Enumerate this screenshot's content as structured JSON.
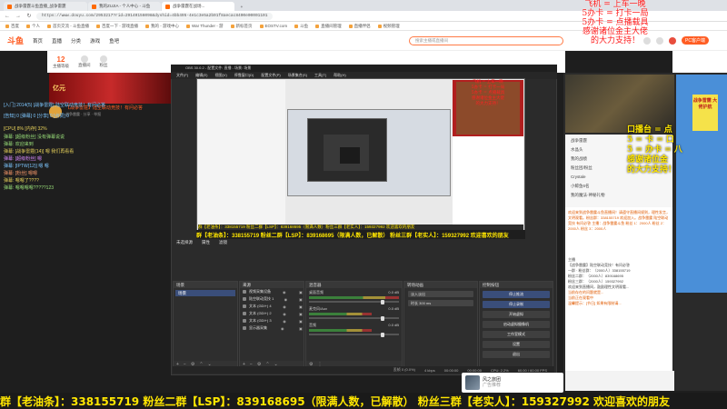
{
  "browser": {
    "tabs": [
      {
        "label": "战争雷霆斗鱼直播_战争雷霆",
        "active": false
      },
      {
        "label": "我的ZUJIA - 个人中心 - 斗鱼",
        "active": false
      },
      {
        "label": "战争雷霆在战场...",
        "active": true
      },
      {
        "label": "",
        "active": false
      }
    ],
    "url": "https://www.douyu.com/2953217?rid=29140156098&dyshid=4bb495-4e1c3e5a2b91f8aecac8400e00001101",
    "bookmarks": [
      "百度",
      "个人",
      "首页交流 - 斗鱼直播",
      "百度一下 - 游戏直播",
      "我的 - 游戏中心",
      "War Thunder - 游",
      "新标签页",
      "EOSTV.com",
      "斗鱼",
      "直播间管理",
      "直播伴侣",
      "视频管理"
    ]
  },
  "douyu": {
    "logo": "斗鱼",
    "nav": [
      "首页",
      "直播",
      "分类",
      "游戏",
      "鱼吧"
    ],
    "search_placeholder": "搜索主播或直播间",
    "pc_button": "PC客户端",
    "stats": [
      {
        "value": "12",
        "label": "主播等级"
      },
      {
        "value": "",
        "label": "直播间"
      },
      {
        "value": "",
        "label": "粉丝"
      }
    ],
    "banner": "亿元",
    "room_title": "【战争雷霆】陆空联动竞技！有问必答",
    "room_meta": "战争雷霆 · 分享 · 举报"
  },
  "chat_left": [
    {
      "text": "[入门] 2014(5) [战争雷霆] 陆空联动竞技！有问必答",
      "color": "c1"
    },
    {
      "text": "[告知] 0 [弹幕] 0 [分享] 0 [点赞] 0",
      "color": "c1"
    },
    {
      "text": "[CPU] 8% [内存] 32%",
      "color": "c2"
    },
    {
      "text": "弹幕: [超级粉丝] 没有弹幕说说",
      "color": "c3"
    },
    {
      "text": "弹幕: 欢迎来到",
      "color": "c3"
    },
    {
      "text": "弹幕: [战争雷霆(14)] 嗯 我们再看看",
      "color": "c2"
    },
    {
      "text": "弹幕: [超级粉丝] 嗯",
      "color": "c4"
    },
    {
      "text": "弹幕: [IPTW(12)] 嗯 嗯",
      "color": "c1"
    },
    {
      "text": "弹幕: [粉丝] 嗯嗯",
      "color": "c5"
    },
    {
      "text": "弹幕: 嗯嗯了????",
      "color": "c2"
    },
    {
      "text": "弹幕: 嗯嗯嗯嗯?????123",
      "color": "c3"
    }
  ],
  "obs": {
    "title": "OBS 30.0.2 - 配置文件: 直播 - 场景: 场景",
    "menu": [
      "文件(F)",
      "编辑(E)",
      "视图(V)",
      "停靠窗口(D)",
      "配置文件(P)",
      "场景集合(S)",
      "工具(T)",
      "帮助(H)"
    ],
    "preview_red_text": [
      "飞机 = 上车一晚",
      "5办卡 = 打卡一局",
      "5办卡 = 点播载具",
      "感谢诸位金主大佬",
      "的大力支持！"
    ],
    "preview_marquee": "群【老油条】：338155719  粉丝二群【LSP】：839168695（限满人数）粉丝三群【老实人】：159327992 欢迎喜欢的朋友",
    "marquee": "群【老油条】：338155719  粉丝二群【LSP】：839168695（限满人数，已解散）  粉丝三群【老实人】：159327992 欢迎喜欢的朋友",
    "scene_bar": [
      "未选择源",
      "属性",
      "滤镜"
    ],
    "docks": {
      "scenes": {
        "title": "场景",
        "items": [
          "场景"
        ]
      },
      "sources": {
        "title": "来源",
        "items": [
          "视频采集设备",
          "陆空联动竞技 1",
          "文本 (GDI+) 4",
          "文本 (GDI+) 2",
          "文本 (GDI+) 3",
          "显示器采集"
        ]
      },
      "mixer": {
        "title": "混音器",
        "channels": [
          {
            "name": "桌面音频",
            "db": "0.0 dB"
          },
          {
            "name": "麦克风/Aux",
            "db": "0.0 dB"
          },
          {
            "name": "音频",
            "db": "0.0 dB"
          }
        ]
      },
      "transitions": {
        "title": "转场动画",
        "type": "淡入淡出",
        "duration_label": "时长",
        "duration": "300 ms"
      },
      "controls": {
        "title": "控制按钮",
        "buttons": [
          "停止推流",
          "停止录制",
          "开始虚拟",
          "启动虚拟摄像机",
          "工作室模式",
          "设置",
          "退出"
        ]
      }
    },
    "status": [
      "丢帧 0 (0.0%)",
      "4 kbps",
      "00:00:00",
      "00:00:00",
      "CPU: 2.2%",
      "60.00 / 60.00 FPS"
    ]
  },
  "overlay_top_right": [
    "飞机 = 上车一晚",
    "5办卡 = 打卡一局",
    "5办卡 = 点播载具",
    "感谢诸位金主大佬",
    "的大力支持！"
  ],
  "overlay_right": [
    "口播台 = 点",
    "5 = 卡 = 口",
    "5 = 办卡 = 八",
    "感谢诸位金",
    "的大力支持！"
  ],
  "right_panel": {
    "sticker": "战争雷霆 大佬护航",
    "list": [
      "战争雷霆",
      "水晶头",
      "我的战绩",
      "粉丝团/粉丝",
      "Crystale",
      "小鲸鱼6名",
      "我的魔法·神秘礼物"
    ],
    "gift_text": "欢迎来到战争雷霆斗鱼直播间！请遵守直播间规则，理性发言，文明观看。粉丝群：338155719 欢迎加入。战争雷霆 陆空联动竞技 有问必答 主播：战争雷霆斗鱼  粉丝 1：2000人 粉丝 2：2000人 粉丝 3：2000人",
    "chat": [
      "主播",
      "【战争雷霆】陆空联动竞技！有问必答",
      "一群 · 粉丝群：（2000人）338155719",
      "粉丝二群：（2000人）839168695",
      "粉丝三群：（2000人）159327992",
      "欢迎来到直播间，鼓励理性文明观看...",
      "当前存在的问题就是...",
      "当前正在观看中",
      "温馨提示：[节日] 如果有限制请..."
    ]
  },
  "thumb_card": {
    "title": "风之旅团",
    "sub": "广告推荐"
  },
  "bottom_marquee": "群【老油条】：338155719  粉丝二群【LSP】：839168695（限满人数，已解散）  粉丝三群【老实人】：159327992 欢迎喜欢的朋友"
}
